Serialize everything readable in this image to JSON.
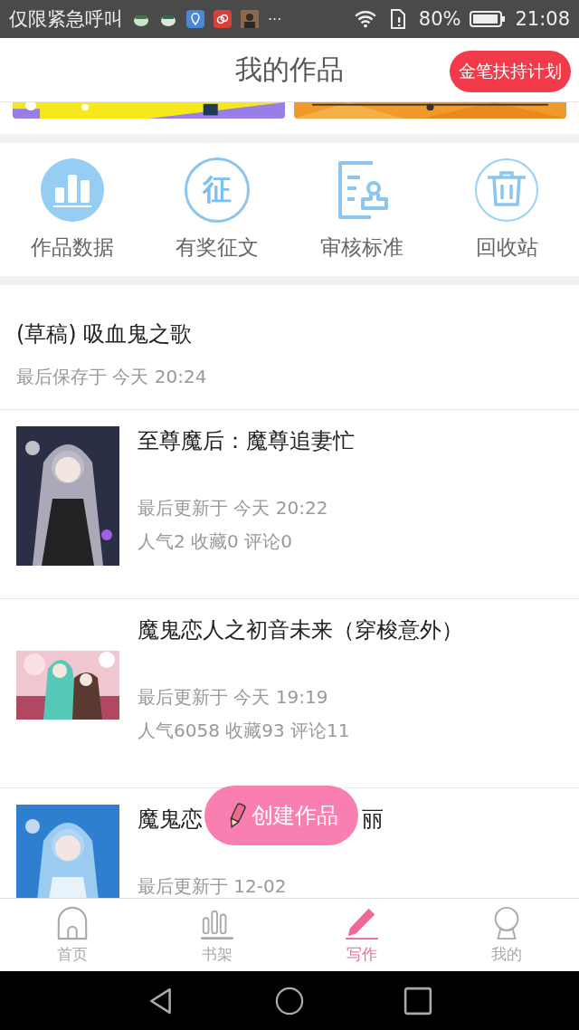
{
  "status_bar": {
    "carrier": "仅限紧急呼叫",
    "more": "···",
    "battery": "80%",
    "time": "21:08"
  },
  "header": {
    "title": "我的作品",
    "promo_button": "金笔扶持计划"
  },
  "shortcuts": [
    {
      "kind": "chart",
      "label": "作品数据"
    },
    {
      "kind": "glyph",
      "glyph": "征",
      "label": "有奖征文"
    },
    {
      "kind": "stamp",
      "label": "审核标准"
    },
    {
      "kind": "trash",
      "label": "回收站"
    }
  ],
  "draft": {
    "title": "(草稿) 吸血鬼之歌",
    "saved": "最后保存于 今天 20:24"
  },
  "works": [
    {
      "kind": "portrait",
      "title": "至尊魔后：魔尊追妻忙",
      "updated": "最后更新于 今天 20:22",
      "stats": "人气2 收藏0 评论0"
    },
    {
      "kind": "landscape",
      "title": "魔鬼恋人之初音未来（穿梭意外）",
      "updated": "最后更新于 今天 19:19",
      "stats": "人气6058 收藏93 评论11"
    },
    {
      "kind": "portrait",
      "title": "魔鬼恋",
      "title_tail": "丽",
      "updated": "最后更新于 12-02"
    }
  ],
  "fab": {
    "label": "创建作品"
  },
  "tabs": [
    {
      "kind": "home",
      "label": "首页",
      "selected": false
    },
    {
      "kind": "shelf",
      "label": "书架",
      "selected": false
    },
    {
      "kind": "write",
      "label": "写作",
      "selected": true
    },
    {
      "kind": "me",
      "label": "我的",
      "selected": false
    }
  ]
}
